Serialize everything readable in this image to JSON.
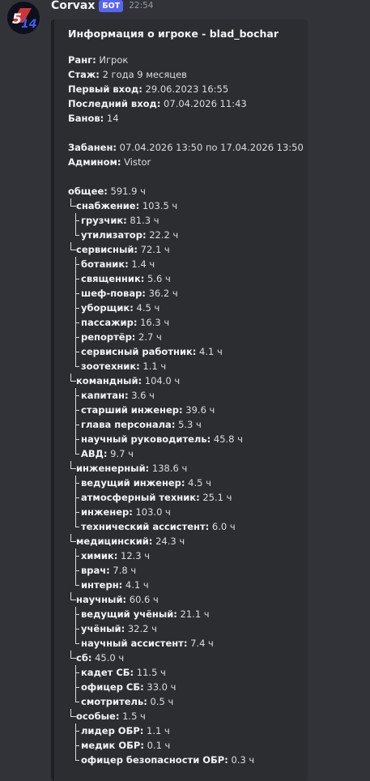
{
  "author": "Corvax",
  "bot_tag": "БОТ",
  "time": "22:54",
  "avatar_text": "S14",
  "title": "Информация о игроке - blad_bochar",
  "info": [
    {
      "k": "Ранг:",
      "v": " Игрок"
    },
    {
      "k": "Стаж:",
      "v": " 2 года 9 месяцев"
    },
    {
      "k": "Первый вход:",
      "v": " 29.06.2023 16:55"
    },
    {
      "k": "Последний вход:",
      "v": " 07.04.2026 11:43"
    },
    {
      "k": "Банов:",
      "v": " 14"
    }
  ],
  "ban": [
    {
      "k": "Забанен:",
      "v": " 07.04.2026 13:50 по 17.04.2026 13:50"
    },
    {
      "k": "Админом:",
      "v": " Vistor"
    }
  ],
  "total": {
    "k": "общее:",
    "v": " 591.9 ч"
  },
  "groups": [
    {
      "k": "снабжение:",
      "v": " 103.5 ч",
      "items": [
        {
          "k": "грузчик:",
          "v": " 81.3 ч"
        },
        {
          "k": "утилизатор:",
          "v": " 22.2 ч"
        }
      ]
    },
    {
      "k": "сервисный:",
      "v": " 72.1 ч",
      "items": [
        {
          "k": "ботаник:",
          "v": " 1.4 ч"
        },
        {
          "k": "священник:",
          "v": " 5.6 ч"
        },
        {
          "k": "шеф-повар:",
          "v": " 36.2 ч"
        },
        {
          "k": "уборщик:",
          "v": " 4.5 ч"
        },
        {
          "k": "пассажир:",
          "v": " 16.3 ч"
        },
        {
          "k": "репортёр:",
          "v": " 2.7 ч"
        },
        {
          "k": "сервисный работник:",
          "v": " 4.1 ч"
        },
        {
          "k": "зоотехник:",
          "v": " 1.1 ч"
        }
      ]
    },
    {
      "k": "командный:",
      "v": " 104.0 ч",
      "items": [
        {
          "k": "капитан:",
          "v": " 3.6 ч"
        },
        {
          "k": "старший инженер:",
          "v": " 39.6 ч"
        },
        {
          "k": "глава персонала:",
          "v": " 5.3 ч"
        },
        {
          "k": "научный руководитель:",
          "v": " 45.8 ч"
        },
        {
          "k": "АВД:",
          "v": " 9.7 ч"
        }
      ]
    },
    {
      "k": "инженерный:",
      "v": " 138.6 ч",
      "items": [
        {
          "k": "ведущий инженер:",
          "v": " 4.5 ч"
        },
        {
          "k": "атмосферный техник:",
          "v": " 25.1 ч"
        },
        {
          "k": "инженер:",
          "v": " 103.0 ч"
        },
        {
          "k": "технический ассистент:",
          "v": " 6.0 ч"
        }
      ]
    },
    {
      "k": "медицинский:",
      "v": " 24.3 ч",
      "items": [
        {
          "k": "химик:",
          "v": " 12.3 ч"
        },
        {
          "k": "врач:",
          "v": " 7.8 ч"
        },
        {
          "k": "интерн:",
          "v": " 4.1 ч"
        }
      ]
    },
    {
      "k": "научный:",
      "v": " 60.6 ч",
      "items": [
        {
          "k": "ведущий учёный:",
          "v": " 21.1 ч"
        },
        {
          "k": "учёный:",
          "v": " 32.2 ч"
        },
        {
          "k": "научный ассистент:",
          "v": " 7.4 ч"
        }
      ]
    },
    {
      "k": "сб:",
      "v": " 45.0 ч",
      "items": [
        {
          "k": "кадет СБ:",
          "v": " 11.5 ч"
        },
        {
          "k": "офицер СБ:",
          "v": " 33.0 ч"
        },
        {
          "k": "смотритель:",
          "v": " 0.5 ч"
        }
      ]
    },
    {
      "k": "особые:",
      "v": " 1.5 ч",
      "items": [
        {
          "k": "лидер ОБР:",
          "v": " 1.1 ч"
        },
        {
          "k": "медик ОБР:",
          "v": " 0.1 ч"
        },
        {
          "k": "офицер безопасности ОБР:",
          "v": " 0.3 ч"
        }
      ]
    }
  ]
}
